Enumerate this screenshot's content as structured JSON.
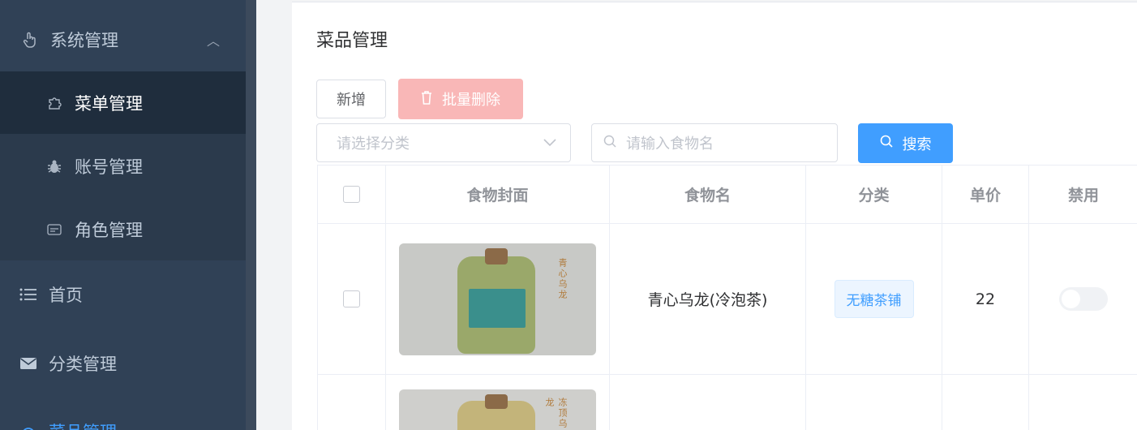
{
  "sidebar": {
    "items": [
      {
        "label": "系统管理",
        "icon": "hand-pointer-icon"
      },
      {
        "label": "菜单管理",
        "icon": "puzzle-icon"
      },
      {
        "label": "账号管理",
        "icon": "bug-icon"
      },
      {
        "label": "角色管理",
        "icon": "id-card-icon"
      },
      {
        "label": "首页",
        "icon": "list-icon"
      },
      {
        "label": "分类管理",
        "icon": "envelope-icon"
      },
      {
        "label": "菜品管理",
        "icon": "dish-icon"
      }
    ],
    "expand_icon": "chevron-up-icon"
  },
  "main": {
    "title": "菜品管理",
    "add_label": "新增",
    "batch_delete_label": "批量删除",
    "category_placeholder": "请选择分类",
    "search_placeholder": "请输入食物名",
    "search_label": "搜索"
  },
  "table": {
    "headers": [
      "食物封面",
      "食物名",
      "分类",
      "单价",
      "禁用"
    ],
    "rows": [
      {
        "cover_text": "青心乌龙",
        "name": "青心乌龙(冷泡茶)",
        "category": "无糖茶铺",
        "price": "22",
        "disabled": false
      },
      {
        "cover_text": "冻顶乌龙"
      }
    ]
  },
  "colors": {
    "sidebar_bg": "#304156",
    "primary": "#409eff",
    "danger_disabled": "#f9b7b7"
  }
}
